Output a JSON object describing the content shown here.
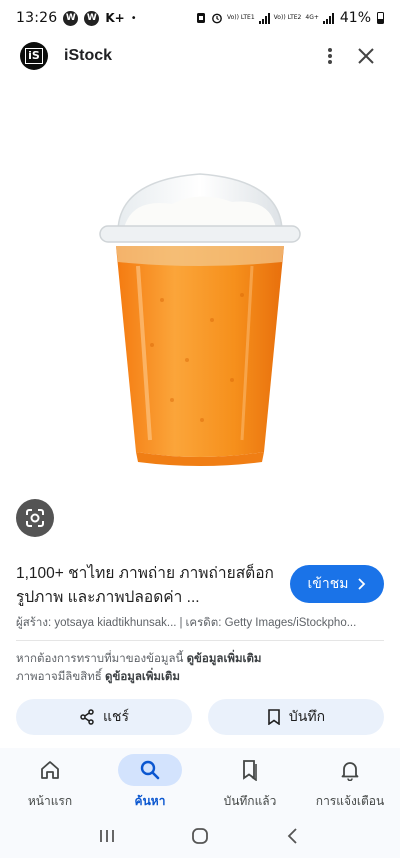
{
  "status_bar": {
    "time": "13:26",
    "notif_badge_1": "W",
    "notif_badge_2": "W",
    "notif_k": "K+",
    "notif_dot": "•",
    "sim1_label": "Vo)) LTE1",
    "sim2_label": "Vo)) LTE2",
    "sim2_net": "4G+",
    "battery": "41%"
  },
  "header": {
    "logo_text": "iS",
    "site_name": "iStock"
  },
  "result": {
    "title": "1,100+ ชาไทย ภาพถ่าย ภาพถ่ายสต็อก รูปภาพ และภาพปลอดค่า ...",
    "visit_label": "เข้าชม",
    "creator": "ผู้สร้าง: yotsaya kiadtikhunsak...",
    "credit": "เครดิต: Getty Images/iStockpho...",
    "notice_line1_text": "หากต้องการทราบที่มาของข้อมูลนี้",
    "notice_line1_link": "ดูข้อมูลเพิ่มเติม",
    "notice_line2_text": "ภาพอาจมีลิขสิทธิ์",
    "notice_line2_link": "ดูข้อมูลเพิ่มเติม"
  },
  "actions": {
    "share": "แชร์",
    "save": "บันทึก"
  },
  "bottom_nav": [
    {
      "label": "หน้าแรก",
      "icon": "home-icon",
      "active": false
    },
    {
      "label": "ค้นหา",
      "icon": "search-icon",
      "active": true
    },
    {
      "label": "บันทึกแล้ว",
      "icon": "saved-icon",
      "active": false
    },
    {
      "label": "การแจ้งเตือน",
      "icon": "bell-icon",
      "active": false
    }
  ],
  "colors": {
    "accent": "#1a73e8",
    "pill_bg": "#eaf1fb",
    "nav_active": "#d3e3fd",
    "drink": "#f7921e"
  }
}
